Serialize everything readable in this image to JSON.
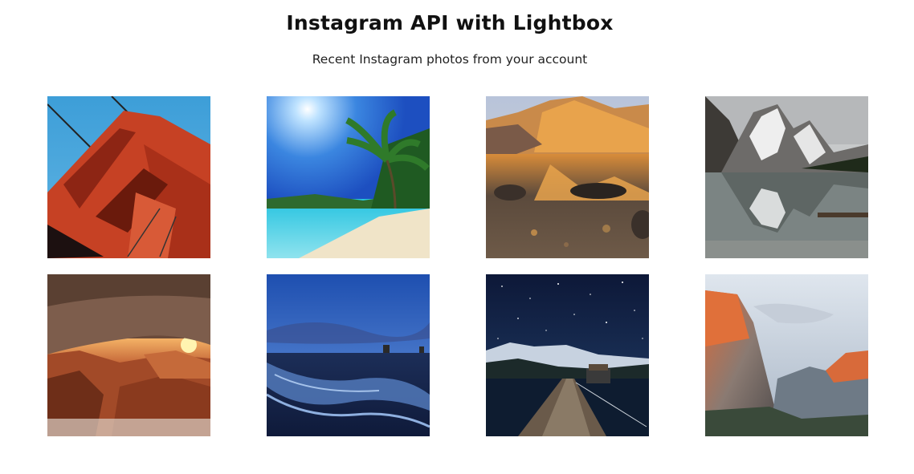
{
  "header": {
    "title": "Instagram API with Lightbox",
    "subtitle": "Recent Instagram photos from your account"
  },
  "photos": [
    {
      "name": "golden-gate-bridge-photo",
      "subject": "Golden Gate Bridge tower"
    },
    {
      "name": "tropical-beach-photo",
      "subject": "Tropical beach with palm tree"
    },
    {
      "name": "mountain-lake-reflection-photo",
      "subject": "Mountain reflected in lake"
    },
    {
      "name": "moraine-lake-photo",
      "subject": "Snowy mountains over lake"
    },
    {
      "name": "mesa-arch-sunrise-photo",
      "subject": "Mesa arch at sunrise"
    },
    {
      "name": "beach-dusk-photo",
      "subject": "Beach at dusk"
    },
    {
      "name": "starry-pier-photo",
      "subject": "Pier under starry sky"
    },
    {
      "name": "el-capitan-photo",
      "subject": "El Capitan cliff"
    }
  ]
}
